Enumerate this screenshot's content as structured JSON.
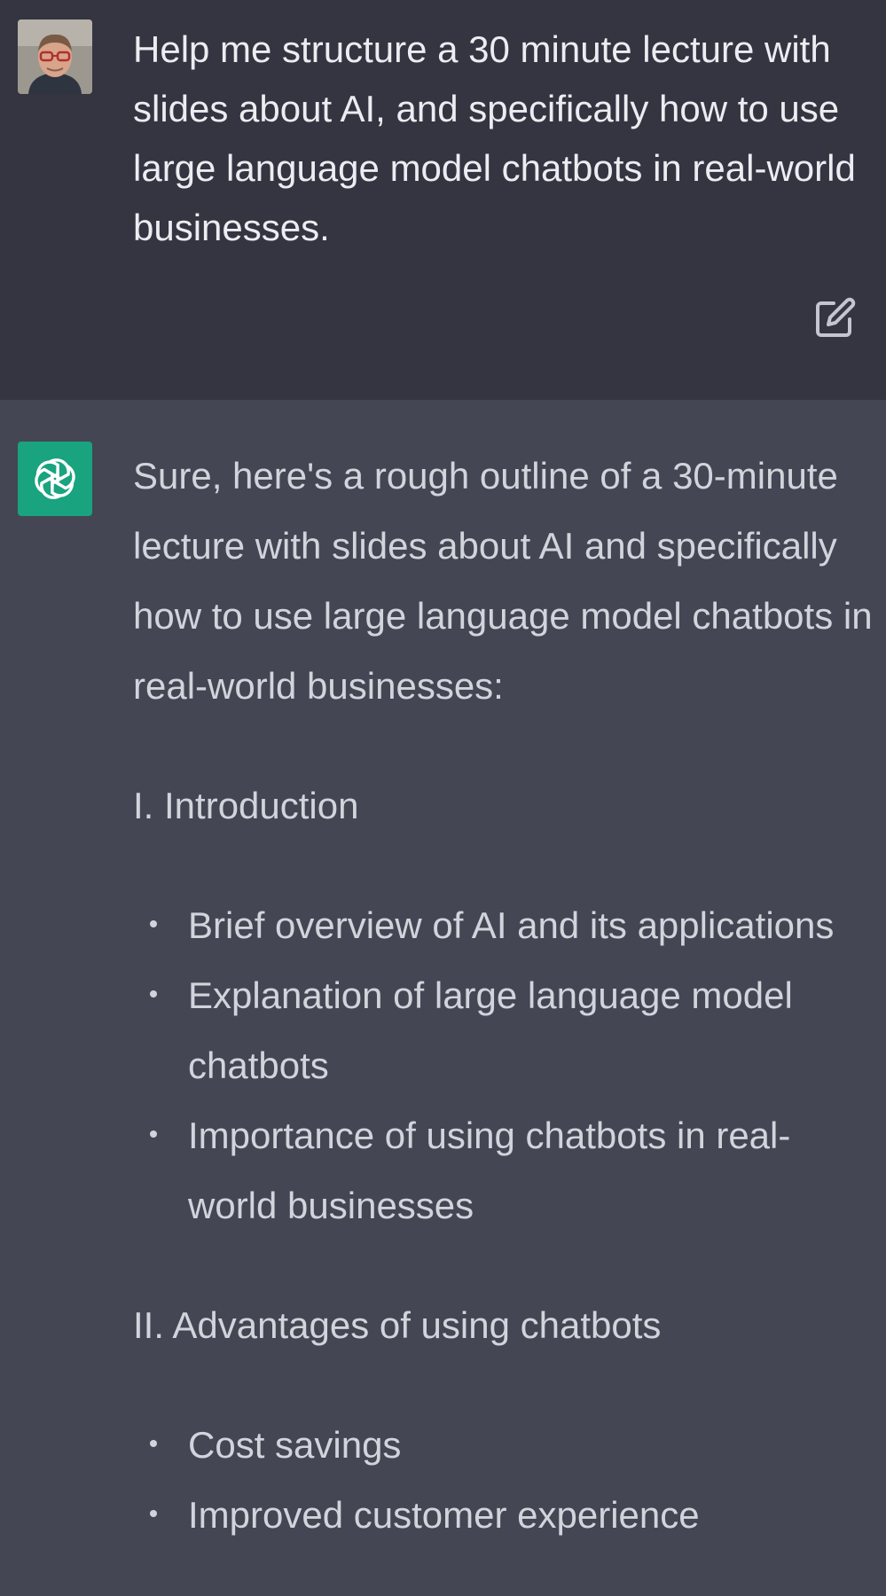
{
  "user_message": {
    "text": "Help me structure a 30 minute lecture with slides about AI, and specifically how to use large language model chatbots in real-world businesses."
  },
  "assistant_message": {
    "intro": "Sure, here's a rough outline of a 30-minute lecture with slides about AI and specifically how to use large language model chatbots in real-world businesses:",
    "sections": [
      {
        "heading": "I. Introduction",
        "bullets": [
          "Brief overview of AI and its applications",
          "Explanation of large language model chatbots",
          "Importance of using chatbots in real-world businesses"
        ]
      },
      {
        "heading": "II. Advantages of using chatbots",
        "bullets": [
          "Cost savings",
          "Improved customer experience"
        ]
      }
    ]
  },
  "icons": {
    "edit": "edit-icon",
    "assistant_logo": "openai-logo-icon",
    "user_avatar": "user-avatar"
  },
  "colors": {
    "user_bg": "#343541",
    "assistant_bg": "#444654",
    "assistant_avatar_bg": "#19a37f",
    "user_text": "#ececf1",
    "assistant_text": "#d1d5db"
  }
}
